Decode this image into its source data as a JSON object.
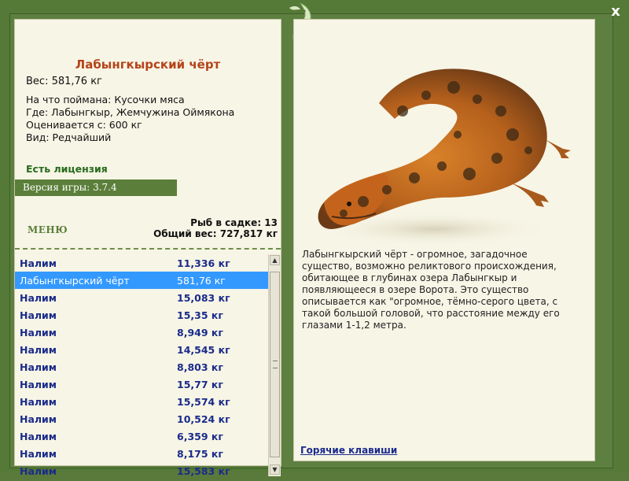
{
  "window": {
    "close_label": "x"
  },
  "fish": {
    "title": "Лабынгкырский чёрт",
    "weight": "Вес: 581,76 кг",
    "details": [
      "На что поймана: Кусочки мяса",
      "Где: Лабынгкыр, Жемчужина Оймякона",
      "Оценивается с: 600 кг",
      "Вид: Редчайший"
    ]
  },
  "license": "Есть лицензия",
  "version": "Версия игры: 3.7.4",
  "menu_label": "МЕНЮ",
  "stats": {
    "fish_count": "Рыб в садке: 13",
    "total_weight": "Общий вес: 727,817 кг"
  },
  "catch_list": [
    {
      "name": "Налим",
      "weight": "11,336 кг"
    },
    {
      "name": "Лабынгкырский чёрт",
      "weight": "581,76 кг"
    },
    {
      "name": "Налим",
      "weight": "15,083 кг"
    },
    {
      "name": "Налим",
      "weight": "15,35 кг"
    },
    {
      "name": "Налим",
      "weight": "8,949 кг"
    },
    {
      "name": "Налим",
      "weight": "14,545 кг"
    },
    {
      "name": "Налим",
      "weight": "8,803 кг"
    },
    {
      "name": "Налим",
      "weight": "15,77 кг"
    },
    {
      "name": "Налим",
      "weight": "15,574 кг"
    },
    {
      "name": "Налим",
      "weight": "10,524 кг"
    },
    {
      "name": "Налим",
      "weight": "6,359 кг"
    },
    {
      "name": "Налим",
      "weight": "8,175 кг"
    },
    {
      "name": "Налим",
      "weight": "15,583 кг"
    }
  ],
  "selected_index": 1,
  "description": "Лабынгкырский чёрт - огромное, загадочное существо, возможно реликтового происхождения, обитающее в глубинах озера Лабынгкыр и появляющееся в озере Ворота. Это существо описывается как \"огромное, тёмно-серого цвета, с такой большой головой, что расстояние между его глазами 1-1,2 метра.",
  "hotkeys_label": "Горячие клавиши",
  "icons": {
    "close": "close-icon",
    "emblem": "fish-emblem-icon",
    "scroll_up": "scroll-up-icon",
    "scroll_down": "scroll-down-icon"
  },
  "colors": {
    "frame": "#557936",
    "panel": "#f7f5e6",
    "title": "#b5441a",
    "list_text": "#1a2b8a",
    "selected": "#3399ff"
  }
}
